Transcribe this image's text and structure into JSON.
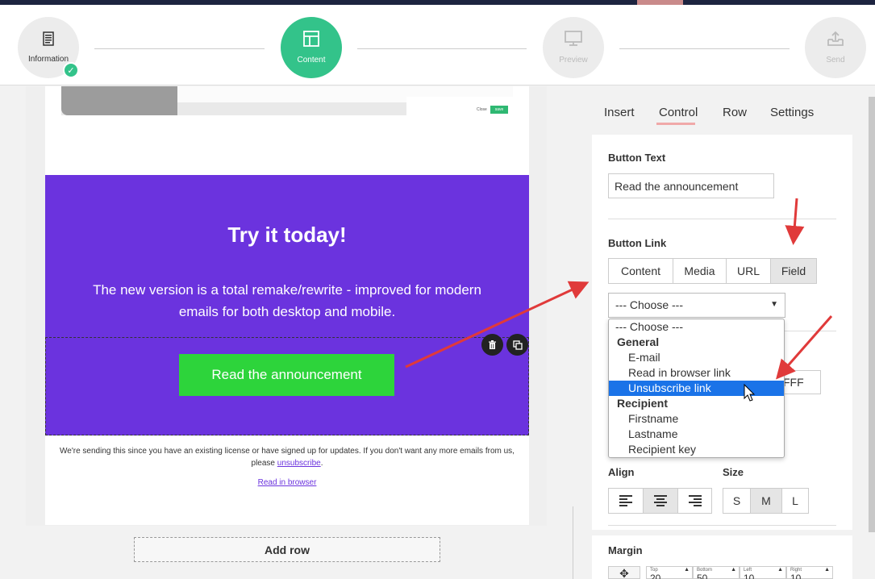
{
  "colors": {
    "accent_green": "#33c38a",
    "purple_block": "#6b33de",
    "cta_green": "#2dd43b",
    "annotation_red": "#e03a3a",
    "selection_blue": "#1a73e8"
  },
  "stepper": {
    "steps": [
      {
        "label": "Information",
        "icon": "document-icon",
        "state": "done"
      },
      {
        "label": "Content",
        "icon": "layout-icon",
        "state": "active"
      },
      {
        "label": "Preview",
        "icon": "monitor-icon",
        "state": "disabled"
      },
      {
        "label": "Send",
        "icon": "send-tray-icon",
        "state": "disabled"
      }
    ]
  },
  "email": {
    "thumb_close": "Close",
    "thumb_save": "save",
    "headline": "Try it today!",
    "description": "The new version is a total remake/rewrite - improved for modern emails for both desktop and mobile.",
    "button_text": "Read the announcement",
    "footer_text": "We're sending this since you have an existing license or have signed up for updates. If you don't want any more emails from us, please ",
    "footer_link": "unsubscribe",
    "footer_end": ".",
    "browser_link": "Read in browser"
  },
  "canvas": {
    "add_row": "Add row"
  },
  "panel": {
    "tabs": [
      "Insert",
      "Control",
      "Row",
      "Settings"
    ],
    "active_tab": "Control",
    "button_text_label": "Button Text",
    "button_text_value": "Read the announcement",
    "button_link_label": "Button Link",
    "link_types": [
      "Content",
      "Media",
      "URL",
      "Field"
    ],
    "active_link_type": "Field",
    "choose_value": "--- Choose ---",
    "hex_partial": "FFF",
    "align_label": "Align",
    "size_label": "Size",
    "sizes": [
      "S",
      "M",
      "L"
    ],
    "active_size": "M",
    "margin_label": "Margin",
    "margins": [
      {
        "label": "Top",
        "value": "20"
      },
      {
        "label": "Bottom",
        "value": "50"
      },
      {
        "label": "Left",
        "value": "10"
      },
      {
        "label": "Right",
        "value": "10"
      }
    ]
  },
  "dropdown": {
    "placeholder": "--- Choose ---",
    "group_general": "General",
    "general_items": [
      "E-mail",
      "Read in browser link",
      "Unsubscribe link"
    ],
    "group_recipient": "Recipient",
    "recipient_items": [
      "Firstname",
      "Lastname",
      "Recipient key"
    ],
    "selected": "Unsubscribe link"
  }
}
